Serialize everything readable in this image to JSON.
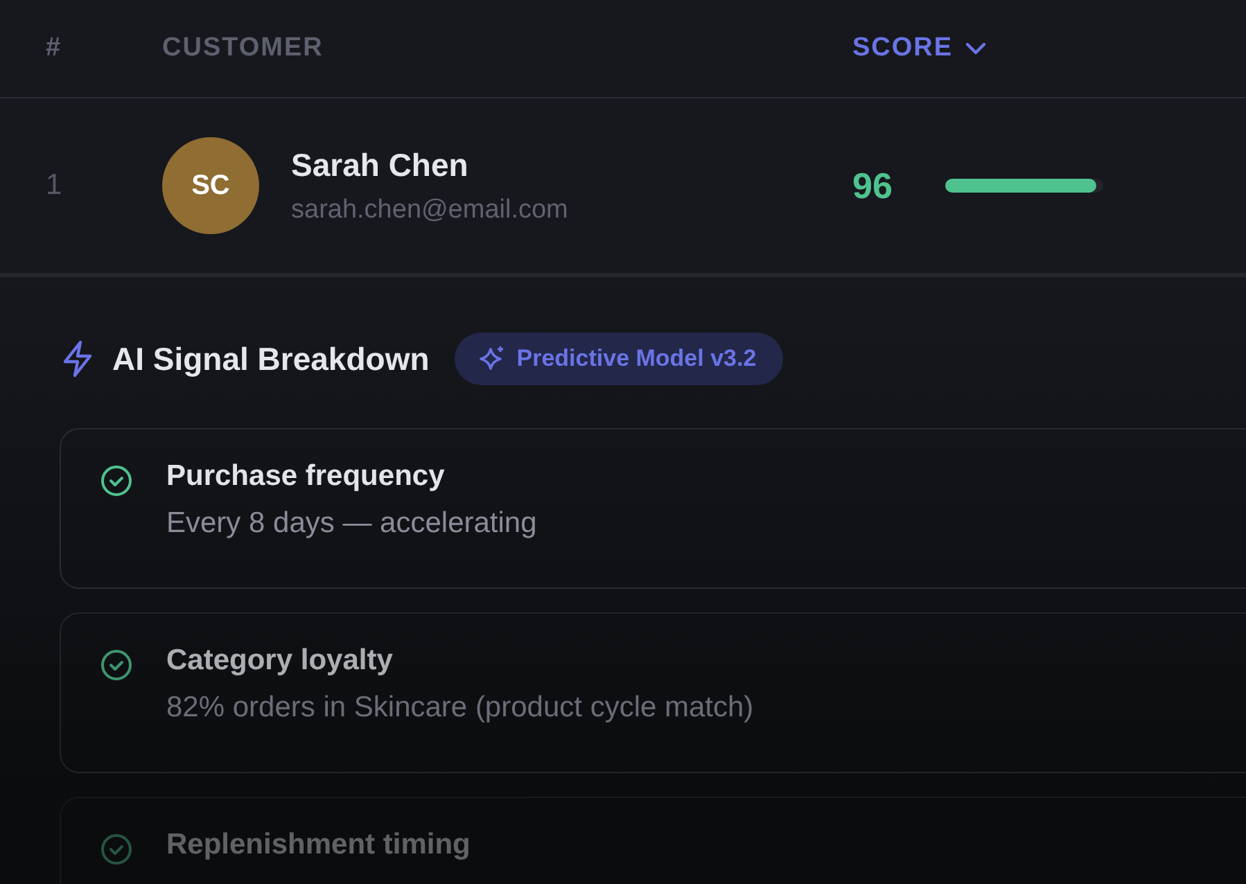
{
  "table": {
    "columns": [
      {
        "label": "#",
        "sorted": false
      },
      {
        "label": "CUSTOMER",
        "sorted": false
      },
      {
        "label": "SCORE",
        "sorted": true
      }
    ],
    "rows": [
      {
        "rank": "1",
        "initials": "SC",
        "name": "Sarah Chen",
        "email": "sarah.chen@email.com",
        "score": "96",
        "level": 0.96
      }
    ]
  },
  "breakdown": {
    "title": "AI Signal Breakdown",
    "badge": "Predictive Model v3.2",
    "signals": [
      {
        "title": "Purchase frequency",
        "detail": "Every 8 days — accelerating",
        "met": true
      },
      {
        "title": "Category loyalty",
        "detail": "82% orders in Skincare (product cycle match)",
        "met": true
      },
      {
        "title": "Replenishment timing",
        "met": true
      }
    ]
  }
}
